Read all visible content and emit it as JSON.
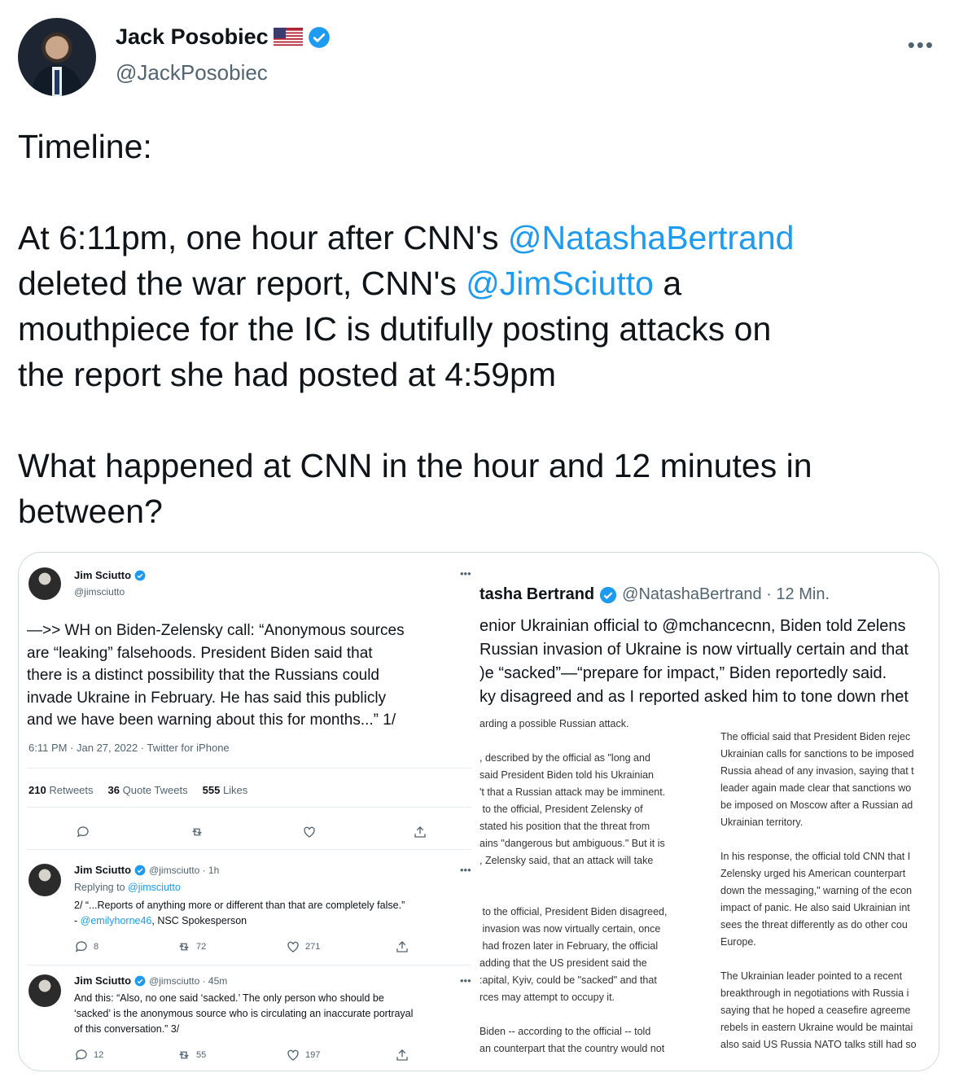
{
  "tweet": {
    "author_name": "Jack Posobiec",
    "author_handle": "@JackPosobiec",
    "more_label": "•••",
    "text_segments": [
      {
        "text": "Timeline:\n\nAt 6:11pm, one hour after CNN's ",
        "type": "text"
      },
      {
        "text": "@NatashaBertrand",
        "type": "mention"
      },
      {
        "text": "\ndeleted the war report, CNN's ",
        "type": "text"
      },
      {
        "text": "@JimSciutto",
        "type": "mention"
      },
      {
        "text": " a\nmouthpiece for the IC is dutifully posting attacks on\nthe report she had posted at 4:59pm\n\nWhat happened at CNN in the hour and 12 minutes in\nbetween?",
        "type": "text"
      }
    ]
  },
  "media_left": {
    "main": {
      "name": "Jim Sciutto",
      "handle": "@jimsciutto",
      "dots": "•••",
      "body": "—>> WH on Biden-Zelensky call: “Anonymous sources\nare “leaking” falsehoods. President Biden said that\nthere is a distinct possibility that the Russians could\ninvade Ukraine in February. He has said this publicly\nand we have been warning about this for months...” 1/",
      "meta": "6:11 PM · Jan 27, 2022 · Twitter for iPhone",
      "retweets_count": "210",
      "retweets_label": "Retweets",
      "quotes_count": "36",
      "quotes_label": "Quote Tweets",
      "likes_count": "555",
      "likes_label": "Likes"
    },
    "reply1": {
      "name": "Jim Sciutto",
      "handle_time": "@jimsciutto · 1h",
      "replying_prefix": "Replying to ",
      "replying_to": "@jimsciutto",
      "text_line1": "2/ “...Reports of anything more or different than that are completely false.”",
      "text_line2_prefix": "- ",
      "text_line2_mention": "@emilyhorne46",
      "text_line2_suffix": ", NSC Spokesperson",
      "replies": "8",
      "retweets": "72",
      "likes": "271",
      "dots": "•••"
    },
    "reply2": {
      "name": "Jim Sciutto",
      "handle_time": "@jimsciutto · 45m",
      "text": "And this: “Also, no one said ‘sacked.’ The only person who should be\n‘sacked’ is the anonymous source who is circulating an inaccurate portrayal\nof this conversation.” 3/",
      "replies": "12",
      "retweets": "55",
      "likes": "197",
      "dots": "•••"
    }
  },
  "media_right": {
    "name": "tasha Bertrand",
    "handle_time": "@NatashaBertrand · 12 Min.",
    "body": "enior Ukrainian official to @mchancecnn, Biden told Zelens\nRussian invasion of Ukraine is now virtually certain and that\n)e “sacked”—“prepare for impact,” Biden reportedly said.\nky disagreed and as I reported asked him to tone down rhet",
    "article_col1": "arding a possible Russian attack.\n\n, described by the official as \"long and\nsaid President Biden told his Ukrainian\n't that a Russian attack may be imminent.\n to the official, President Zelensky of\nstated his position that the threat from\nains \"dangerous but ambiguous.\" But it is\n, Zelensky said, that an attack will take\n\n\n to the official, President Biden disagreed,\n invasion was now virtually certain, once\n had frozen later in February, the official\nadding that the US president said the\n:apital, Kyiv, could be \"sacked\" and that\nrces may attempt to occupy it.\n\nBiden -- according to the official -- told\nan counterpart that the country would not",
    "article_col2": "The official said that President Biden rejec\nUkrainian calls for sanctions to be imposed\nRussia ahead of any invasion, saying that t\nleader again made clear that sanctions wo\nbe imposed on Moscow after a Russian ad\nUkrainian territory.\n\nIn his response, the official told CNN that I\nZelensky urged his American counterpart\ndown the messaging,\" warning of the econ\nimpact of panic. He also said Ukrainian int\nsees the threat differently as do other cou\nEurope.\n\nThe Ukrainian leader pointed to a recent\nbreakthrough in negotiations with Russia i\nsaying that he hoped a ceasefire agreeme\nrebels in eastern Ukraine would be maintai\nalso said US Russia NATO talks still had so"
  },
  "colors": {
    "accent": "#1d9bf0",
    "text": "#0f1419",
    "muted": "#536471"
  }
}
